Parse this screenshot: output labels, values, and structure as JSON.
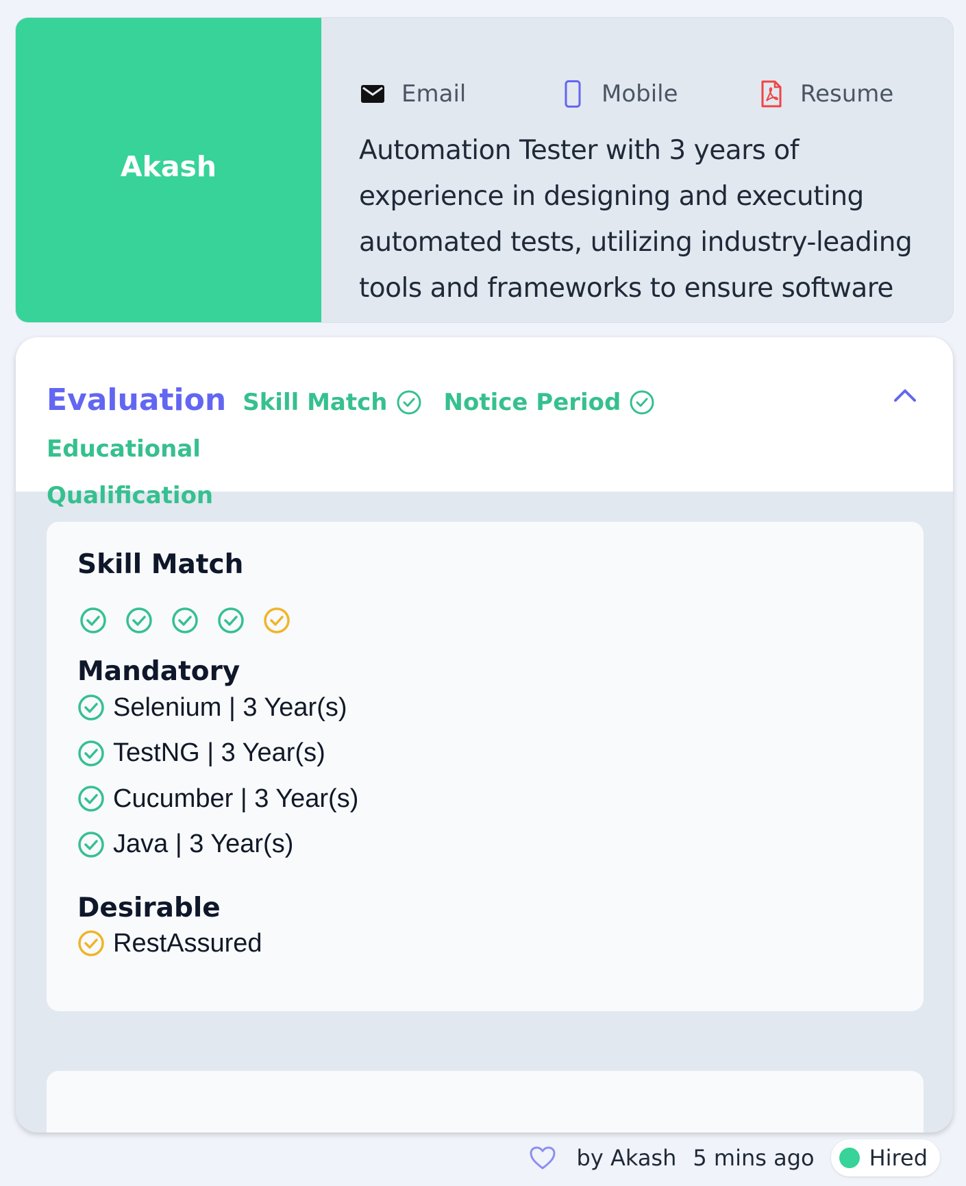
{
  "candidate": {
    "name": "Akash",
    "contact": {
      "email_label": "Email",
      "mobile_label": "Mobile",
      "resume_label": "Resume"
    },
    "summary": "Automation Tester with 3 years of experience in designing and executing automated tests, utilizing industry-leading tools and frameworks to ensure software quality and reliability. Proficient in Agile/Scrum"
  },
  "evaluation": {
    "title": "Evaluation",
    "tags": [
      "Skill Match",
      "Notice Period",
      "Educational Qualification"
    ],
    "skill_match": {
      "title": "Skill Match",
      "score": {
        "met": 4,
        "partial": 1,
        "total": 5
      },
      "mandatory_label": "Mandatory",
      "mandatory": [
        "Selenium | 3 Year(s)",
        "TestNG | 3 Year(s)",
        "Cucumber | 3 Year(s)",
        "Java | 3 Year(s)"
      ],
      "desirable_label": "Desirable",
      "desirable": [
        "RestAssured"
      ]
    }
  },
  "footer": {
    "author": "by Akash",
    "time": "5 mins ago",
    "status": "Hired"
  },
  "colors": {
    "accent_green": "#37d399",
    "tag_green": "#36c08f",
    "indigo": "#6366f1",
    "warning": "#f0b429"
  },
  "icons": {
    "email": "envelope-icon",
    "mobile": "phone-icon",
    "resume": "pdf-icon",
    "check": "check-circle-icon",
    "collapse": "chevron-up-icon",
    "like": "heart-icon"
  }
}
